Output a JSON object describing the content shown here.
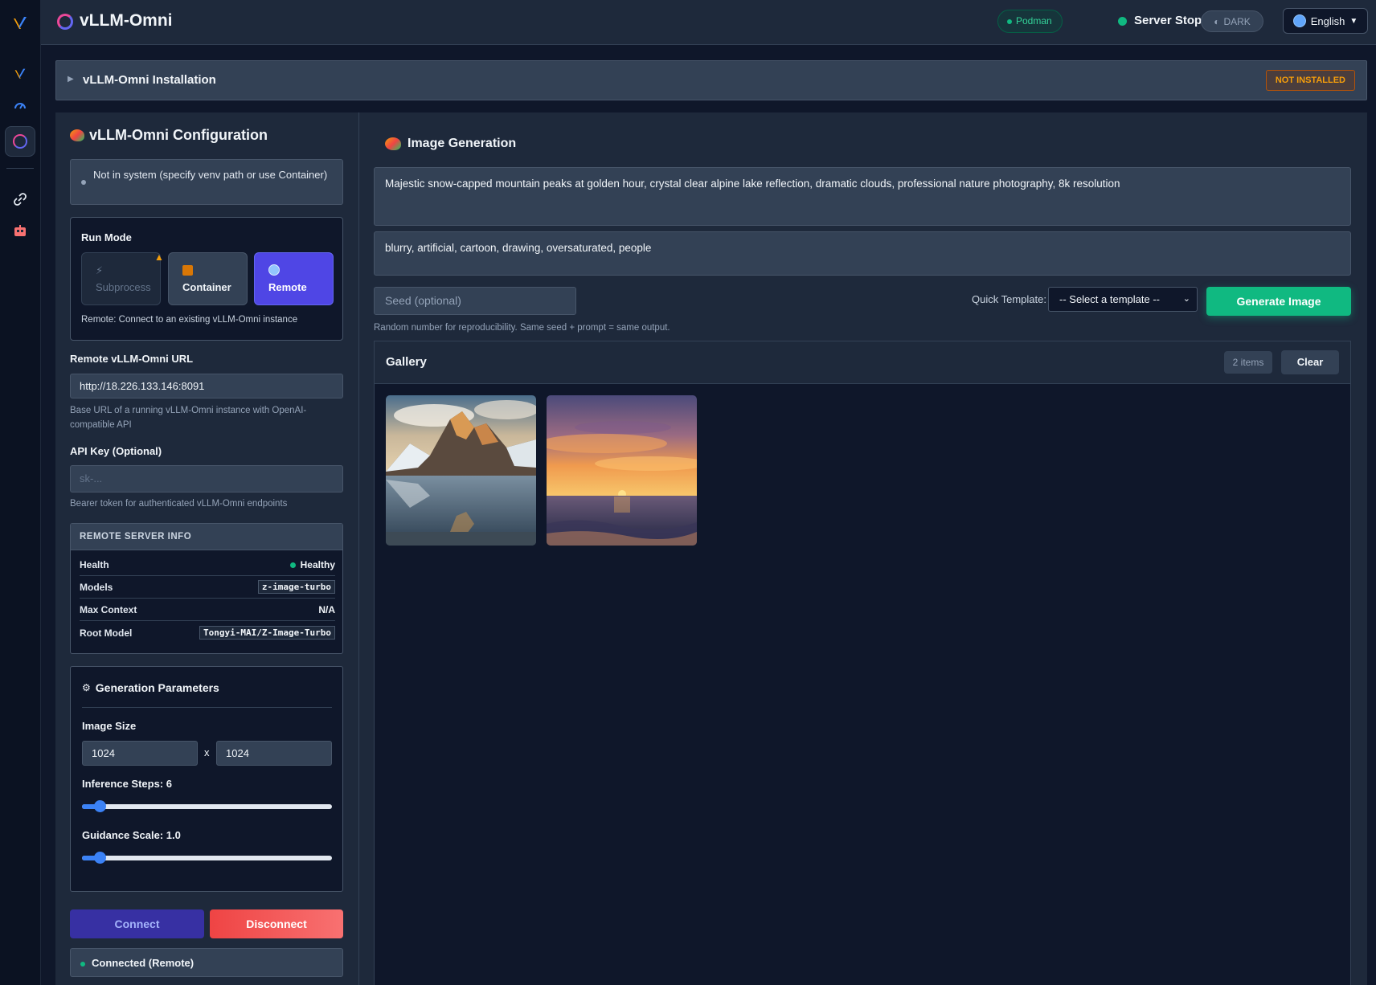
{
  "header": {
    "app_title": "vLLM-Omni",
    "runtime_badge": "Podman",
    "server_status": "Server Stopped",
    "theme_label": "DARK",
    "language": "English"
  },
  "installation": {
    "title": "vLLM-Omni Installation",
    "badge": "NOT INSTALLED"
  },
  "config": {
    "title": "vLLM-Omni Configuration",
    "system_status": "Not in system (specify venv path or use Container)",
    "run_mode": {
      "label": "Run Mode",
      "options": [
        "Subprocess",
        "Container",
        "Remote"
      ],
      "selected": "Remote",
      "description": "Remote: Connect to an existing vLLM-Omni instance"
    },
    "remote_url": {
      "label": "Remote vLLM-Omni URL",
      "value": "http://18.226.133.146:8091",
      "helper": "Base URL of a running vLLM-Omni instance with OpenAI-compatible API"
    },
    "api_key": {
      "label": "API Key (Optional)",
      "placeholder": "sk-...",
      "helper": "Bearer token for authenticated vLLM-Omni endpoints"
    },
    "server_info": {
      "title": "REMOTE SERVER INFO",
      "rows": [
        {
          "key": "Health",
          "value": "Healthy"
        },
        {
          "key": "Models",
          "value": "z-image-turbo"
        },
        {
          "key": "Max Context",
          "value": "N/A"
        },
        {
          "key": "Root Model",
          "value": "Tongyi-MAI/Z-Image-Turbo"
        }
      ]
    },
    "gen_params": {
      "title": "Generation Parameters",
      "image_size_label": "Image Size",
      "width": "1024",
      "height": "1024",
      "separator": "x",
      "steps_label": "Inference Steps: 6",
      "steps_fraction": 0.07,
      "guidance_label": "Guidance Scale: 1.0",
      "guidance_fraction": 0.07
    },
    "connect_label": "Connect",
    "disconnect_label": "Disconnect",
    "connection_status": "Connected (Remote)"
  },
  "generation": {
    "title": "Image Generation",
    "prompt": "Majestic snow-capped mountain peaks at golden hour, crystal clear alpine lake reflection, dramatic clouds, professional nature photography, 8k resolution",
    "negative_prompt": "blurry, artificial, cartoon, drawing, oversaturated, people",
    "seed_placeholder": "Seed (optional)",
    "seed_help": "Random number for reproducibility. Same seed + prompt = same output.",
    "quick_template_label": "Quick Template:",
    "quick_template_value": "-- Select a template --",
    "generate_label": "Generate Image"
  },
  "gallery": {
    "title": "Gallery",
    "count": "2 items",
    "clear_label": "Clear",
    "images": [
      "mountain-lake-reflection",
      "ocean-sunset"
    ]
  }
}
